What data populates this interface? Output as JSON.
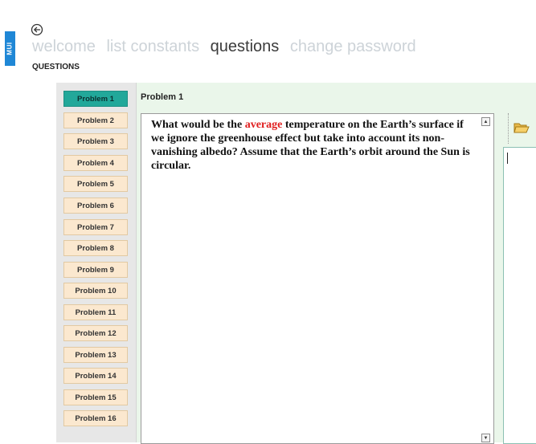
{
  "app": {
    "side_tab_label": "MUI"
  },
  "nav": {
    "items": [
      {
        "label": "welcome",
        "active": false
      },
      {
        "label": "list constants",
        "active": false
      },
      {
        "label": "questions",
        "active": true
      },
      {
        "label": "change password",
        "active": false
      }
    ]
  },
  "page": {
    "label": "QUESTIONS"
  },
  "problems": {
    "items": [
      {
        "label": "Problem 1",
        "selected": true
      },
      {
        "label": "Problem 2"
      },
      {
        "label": "Problem 3"
      },
      {
        "label": "Problem 4"
      },
      {
        "label": "Problem 5"
      },
      {
        "label": "Problem 6"
      },
      {
        "label": "Problem 7"
      },
      {
        "label": "Problem 8"
      },
      {
        "label": "Problem 9"
      },
      {
        "label": "Problem 10"
      },
      {
        "label": "Problem 11"
      },
      {
        "label": "Problem 12"
      },
      {
        "label": "Problem 13"
      },
      {
        "label": "Problem 14"
      },
      {
        "label": "Problem 15"
      },
      {
        "label": "Problem 16"
      }
    ]
  },
  "question": {
    "title": "Problem 1",
    "text_before": "What would be the ",
    "highlight": "average",
    "text_after": " temperature on the Earth’s surface if we ignore the greenhouse effect but take into account its non-vanishing albedo? Assume that the Earth’s orbit around the Sun is circular."
  },
  "colors": {
    "accent_selected": "#22a89a",
    "problem_button": "#fbe8cf",
    "highlight_word": "#e02020",
    "side_tab": "#1f87d6"
  },
  "icons": {
    "back": "back-arrow-icon",
    "open": "open-folder-icon"
  }
}
